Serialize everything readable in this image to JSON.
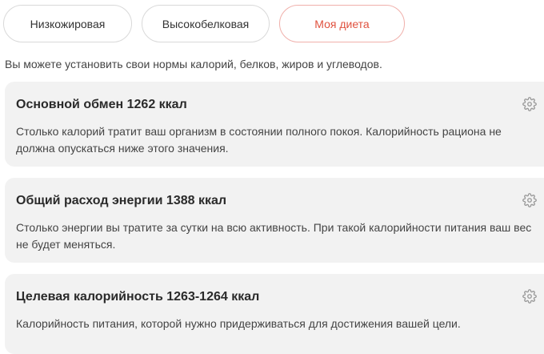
{
  "tabs": [
    {
      "label": "Низкожировая",
      "active": false
    },
    {
      "label": "Высокобелковая",
      "active": false
    },
    {
      "label": "Моя диета",
      "active": true
    }
  ],
  "intro": "Вы можете установить свои нормы калорий, белков, жиров и углеводов.",
  "cards": [
    {
      "title": "Основной обмен 1262 ккал",
      "text": "Столько калорий тратит ваш организм в состоянии полного покоя. Калорийность рациона не должна опускаться ниже этого значения.",
      "icon": "gear-icon"
    },
    {
      "title": "Общий расход энергии 1388 ккал",
      "text": "Столько энергии вы тратите за сутки на всю активность. При такой калорийности питания ваш вес не будет меняться.",
      "icon": "gear-icon"
    },
    {
      "title": "Целевая калорийность 1263-1264 ккал",
      "text": "Калорийность питания, которой нужно придерживаться для достижения вашей цели.",
      "icon": "gear-icon"
    }
  ],
  "colors": {
    "accent": "#e0523f",
    "accent_border": "#f0b0ab",
    "card_bg": "#f2f2f2",
    "icon": "#9a9a9a"
  }
}
